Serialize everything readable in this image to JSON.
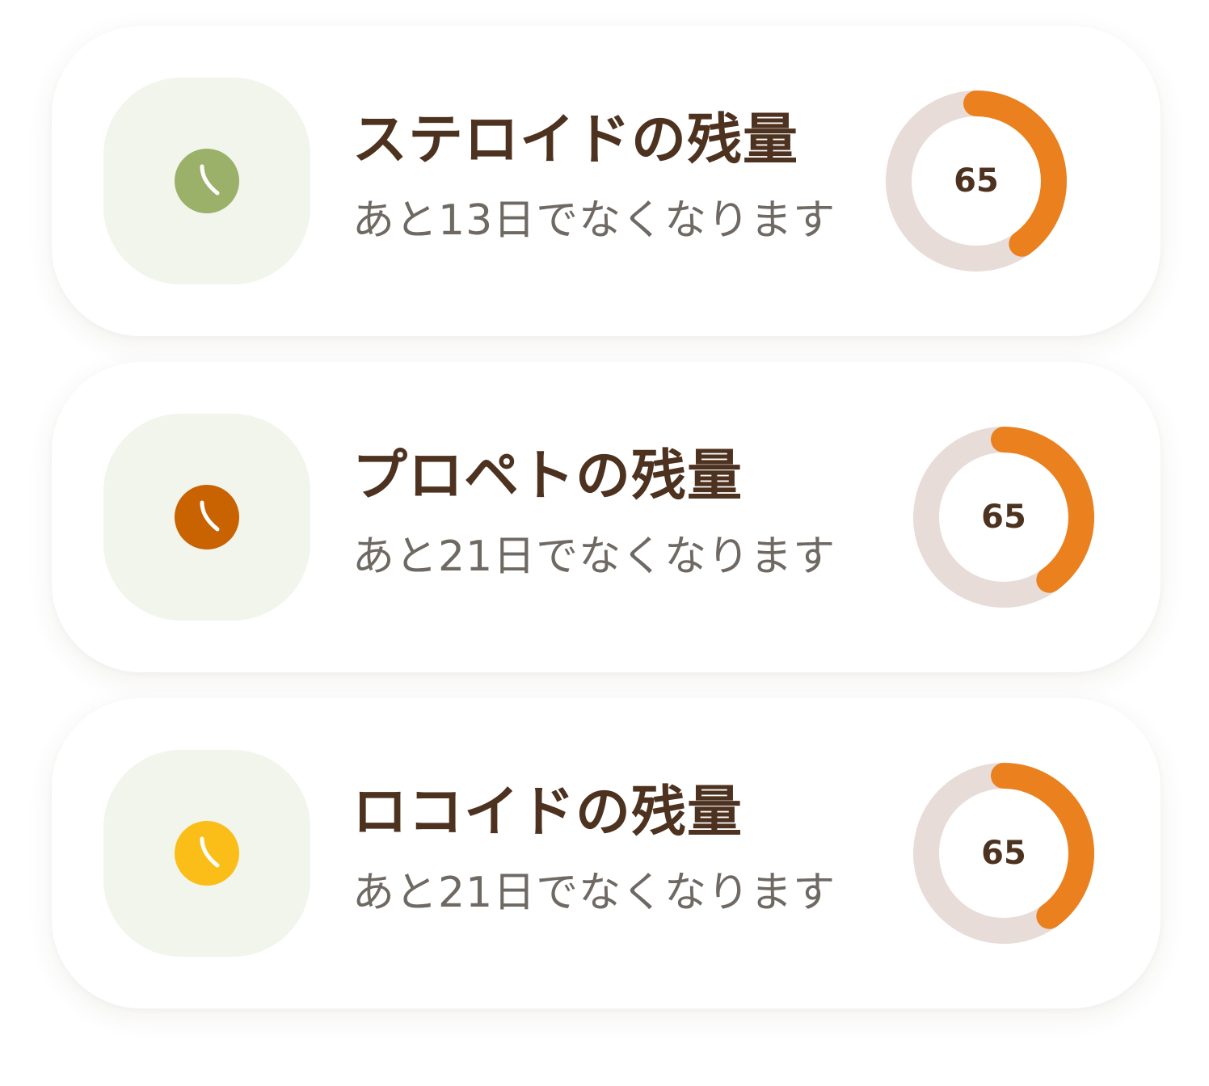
{
  "colors": {
    "title": "#4e3220",
    "subtitle": "#6f6963",
    "tile_bg": "#f1f5ec",
    "gauge_track": "#e8dcd9",
    "gauge_fill": "#ea801e"
  },
  "items": [
    {
      "title": "ステロイドの残量",
      "subtitle": "あと13日でなくなります",
      "gauge_value": "65",
      "gauge_fraction": 0.4,
      "icon": "clock-icon",
      "icon_color": "#9bb069"
    },
    {
      "title": "プロペトの残量",
      "subtitle": "あと21日でなくなります",
      "gauge_value": "65",
      "gauge_fraction": 0.4,
      "icon": "clock-icon",
      "icon_color": "#c96200"
    },
    {
      "title": "ロコイドの残量",
      "subtitle": "あと21日でなくなります",
      "gauge_value": "65",
      "gauge_fraction": 0.4,
      "icon": "clock-icon",
      "icon_color": "#fbbd18"
    }
  ]
}
